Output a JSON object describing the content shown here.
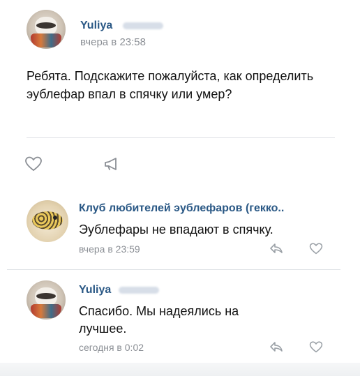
{
  "post": {
    "author_name": "Yuliya",
    "time": "вчера в 23:58",
    "text": "Ребята. Подскажите пожалуйста, как определить эублефар впал в спячку или умер?",
    "actions": {
      "like_icon": "heart-icon",
      "reply_icon": "megaphone-icon"
    }
  },
  "comments": [
    {
      "author_name": "Клуб любителей эублефаров (гекко..",
      "text": "Эублефары не впадают в спячку.",
      "time": "вчера в 23:59",
      "reply_icon": "reply-arrow-icon",
      "like_icon": "heart-icon"
    },
    {
      "author_name": "Yuliya",
      "text": "Спасибо. Мы надеялись на лучшее.",
      "time": "сегодня в 0:02",
      "reply_icon": "reply-arrow-icon",
      "like_icon": "heart-icon"
    }
  ],
  "colors": {
    "link": "#2a5885",
    "meta": "#8b8f95",
    "divider": "#dfe2e6"
  }
}
